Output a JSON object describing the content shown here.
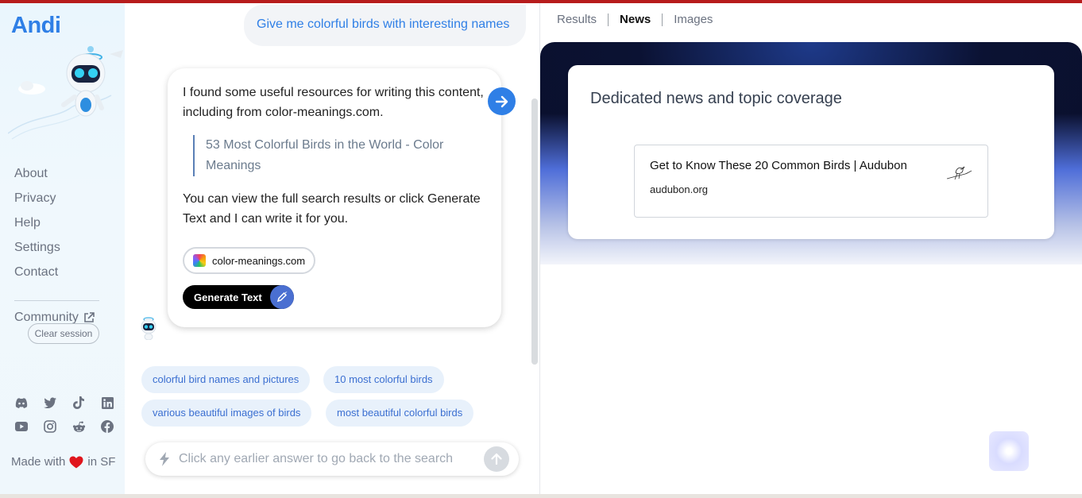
{
  "app": {
    "logo": "Andi"
  },
  "sidebar": {
    "nav": [
      {
        "label": "About"
      },
      {
        "label": "Privacy"
      },
      {
        "label": "Help"
      },
      {
        "label": "Settings"
      },
      {
        "label": "Contact"
      }
    ],
    "community_label": "Community",
    "clear_session_label": "Clear session",
    "socials": [
      "discord-icon",
      "twitter-icon",
      "tiktok-icon",
      "linkedin-icon",
      "youtube-icon",
      "instagram-icon",
      "reddit-icon",
      "facebook-icon"
    ],
    "made_with_prefix": "Made with",
    "made_with_suffix": "in SF"
  },
  "chat": {
    "user_query": "Give me colorful birds with interesting names",
    "answer": {
      "intro": "I found some useful resources for writing this content, including from color-meanings.com.",
      "source_title": "53 Most Colorful Birds in the World - Color Meanings",
      "outro": "You can view the full search results or click Generate Text and I can write it for you.",
      "source_chip": "color-meanings.com",
      "generate_label": "Generate Text"
    },
    "suggestions": [
      "colorful bird names and pictures",
      "10 most colorful birds",
      "various beautiful images of birds",
      "most beautiful colorful birds"
    ],
    "search_placeholder": "Click any earlier answer to go back to the search"
  },
  "results": {
    "tabs": [
      {
        "label": "Results",
        "active": false
      },
      {
        "label": "News",
        "active": true
      },
      {
        "label": "Images",
        "active": false
      }
    ],
    "news_heading": "Dedicated news and topic coverage",
    "article": {
      "title": "Get to Know These 20 Common Birds | Audubon",
      "source": "audubon.org"
    }
  },
  "colors": {
    "accent": "#2f7fe6",
    "topbar": "#b71c1c",
    "suggestion_bg": "#e8f1fb"
  }
}
